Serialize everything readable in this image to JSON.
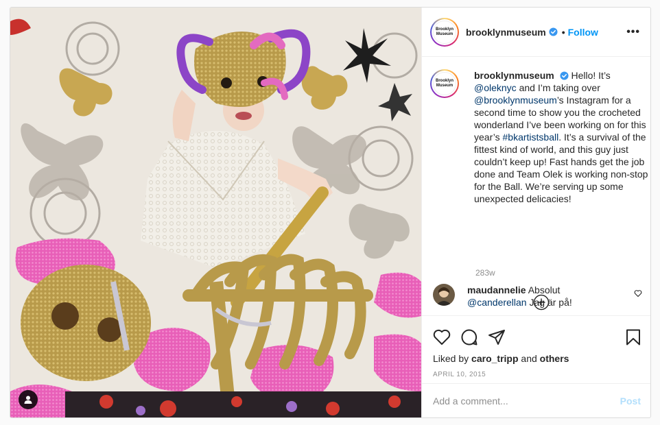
{
  "account": {
    "username": "brooklynmuseum",
    "logo_line1": "Brooklyn",
    "logo_line2": "Museum",
    "follow_label": "Follow",
    "separator": "•",
    "more_label": "•••"
  },
  "caption": {
    "username": "brooklynmuseum",
    "text_1": "Hello! It’s",
    "mention_1": "@oleknyc",
    "text_2": " and I’m taking over ",
    "mention_2": "@brooklynmuseum",
    "text_3": "’s Instagram for a second time to show you the crocheted wonderland I’ve been working on for this year’s ",
    "hashtag": "#bkartistsball",
    "text_4": ". It’s a survival of the fittest kind of world, and this guy just couldn’t keep up! Fast hands get the job done and Team Olek is working non-stop for the Ball. We’re serving up some unexpected delicacies!",
    "time": "283w"
  },
  "comment": {
    "username": "maudannelie",
    "text_1": "Absolut",
    "mention": "@canderellan",
    "text_2": "Jag är på!"
  },
  "likes": {
    "prefix": "Liked by ",
    "user": "caro_tripp",
    "middle": " and ",
    "others": "others"
  },
  "date": "APRIL 10, 2015",
  "add_comment": {
    "placeholder": "Add a comment...",
    "post_label": "Post"
  },
  "icons": {
    "verified": "verified-badge-icon",
    "tag": "user-tag-icon",
    "load_more": "plus-circle-icon",
    "like": "heart-icon",
    "comment": "comment-bubble-icon",
    "share": "paper-plane-icon",
    "save": "bookmark-icon"
  },
  "colors": {
    "accent": "#0095f6",
    "link": "#00376b",
    "muted": "#8e8e8e",
    "post_disabled": "#b2dffc"
  }
}
